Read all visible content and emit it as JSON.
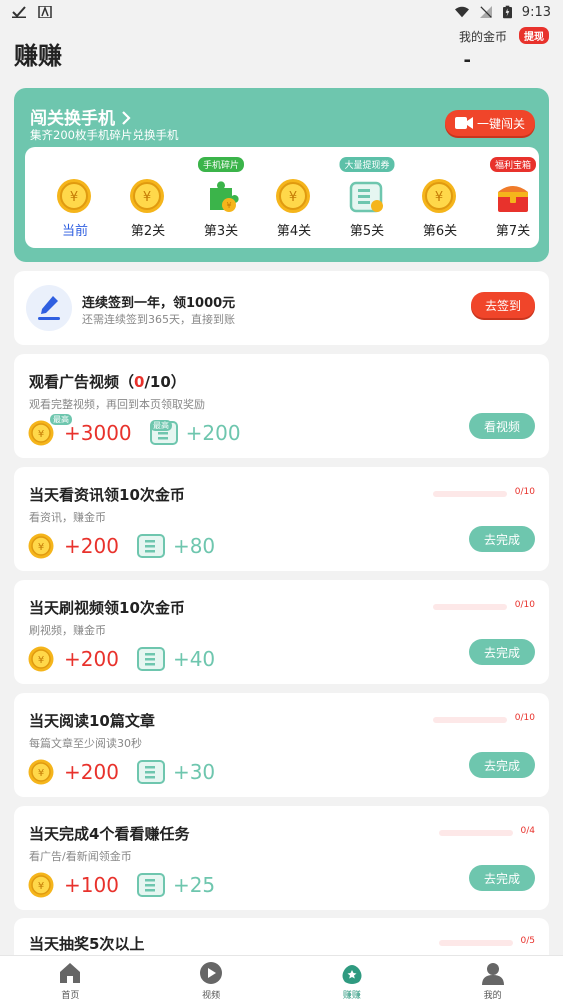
{
  "status": {
    "time": "9:13"
  },
  "header": {
    "title": "赚赚",
    "coin_label": "我的金币",
    "withdraw": "提现",
    "coin_value": "-"
  },
  "banner": {
    "title": "闯关换手机 ",
    "subtitle": "集齐200枚手机碎片兑换手机",
    "button": "一键闯关",
    "levels": [
      {
        "label": "当前",
        "icon": "gold-coin-icon",
        "tag": ""
      },
      {
        "label": "第2关",
        "icon": "gold-coin-icon",
        "tag": ""
      },
      {
        "label": "第3关",
        "icon": "phone-fragment-icon",
        "tag": "手机碎片"
      },
      {
        "label": "第4关",
        "icon": "gold-coin-icon",
        "tag": ""
      },
      {
        "label": "第5关",
        "icon": "withdraw-voucher-icon",
        "tag": "大量提现券"
      },
      {
        "label": "第6关",
        "icon": "gold-coin-icon",
        "tag": ""
      },
      {
        "label": "第7关",
        "icon": "treasure-chest-icon",
        "tag": "福利宝箱"
      }
    ]
  },
  "signin": {
    "title": "连续签到一年，领1000元",
    "subtitle": "还需连续签到365天，直接到账",
    "button": "去签到"
  },
  "tasks": [
    {
      "title_prefix": "观看广告视频（",
      "title_hl": "0",
      "title_suffix": "/10）",
      "subtitle": "观看完整视频，再回到本页领取奖励",
      "coin": "+3000",
      "ticket": "+200",
      "max_tag": "最高",
      "button": "看视频"
    },
    {
      "title": "当天看资讯领10次金币",
      "subtitle": "看资讯，赚金币",
      "coin": "+200",
      "ticket": "+80",
      "progress_text": "0/10",
      "progress": 0,
      "button": "去完成"
    },
    {
      "title": "当天刷视频领10次金币",
      "subtitle": "刷视频，赚金币",
      "coin": "+200",
      "ticket": "+40",
      "progress_text": "0/10",
      "progress": 0,
      "button": "去完成"
    },
    {
      "title": "当天阅读10篇文章",
      "subtitle": "每篇文章至少阅读30秒",
      "coin": "+200",
      "ticket": "+30",
      "progress_text": "0/10",
      "progress": 0,
      "button": "去完成"
    },
    {
      "title": "当天完成4个看看赚任务",
      "subtitle": "看广告/看新闻领金币",
      "coin": "+100",
      "ticket": "+25",
      "progress_text": "0/4",
      "progress": 0,
      "button": "去完成"
    },
    {
      "title": "当天抽奖5次以上",
      "progress_text": "0/5",
      "progress": 0
    }
  ],
  "nav": [
    {
      "label": "首页",
      "icon": "home-icon"
    },
    {
      "label": "视频",
      "icon": "video-play-icon"
    },
    {
      "label": "赚赚",
      "icon": "earn-icon",
      "active": true
    },
    {
      "label": "我的",
      "icon": "profile-icon"
    }
  ],
  "colors": {
    "accent": "#6ec6ae",
    "red": "#e8322c",
    "active_nav": "#2f9a80"
  }
}
